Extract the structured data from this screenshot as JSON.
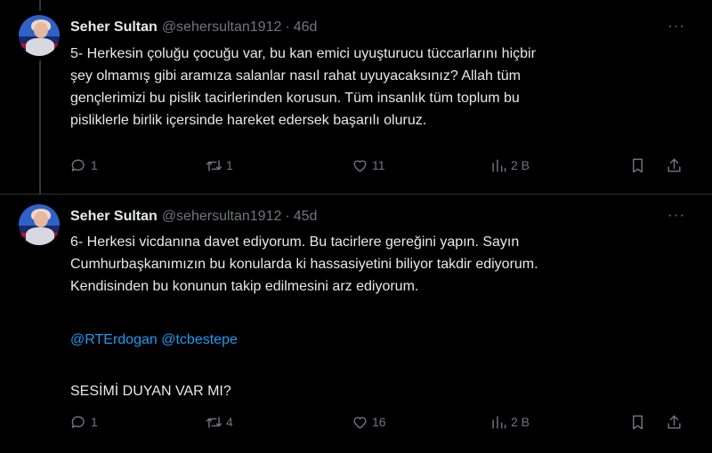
{
  "tweets": [
    {
      "author_name": "Seher Sultan",
      "handle": "@sehersultan1912",
      "separator": "·",
      "time": "46d",
      "body_lines": [
        "5- Herkesin çoluğu çocuğu var, bu kan emici uyuşturucu tüccarlarını hiçbir",
        "şey olmamış gibi aramıza salanlar nasıl rahat uyuyacaksınız? Allah tüm",
        "gençlerimizi bu pislik tacirlerinden korusun. Tüm insanlık tüm toplum bu",
        "pisliklerle birlik içersinde hareket edersek başarılı oluruz."
      ],
      "replies": "1",
      "retweets": "1",
      "likes": "11",
      "views": "2 B"
    },
    {
      "author_name": "Seher Sultan",
      "handle": "@sehersultan1912",
      "separator": "·",
      "time": "45d",
      "body_lines": [
        "6- Herkesi vicdanına davet ediyorum. Bu tacirlere gereğini yapın. Sayın",
        "Cumhurbaşkanımızın bu konularda ki hassasiyetini biliyor takdir ediyorum.",
        "Kendisinden bu konunun takip edilmesini arz ediyorum."
      ],
      "mentions": [
        "@RTErdogan",
        "@tcbestepe"
      ],
      "closing_line": "SESİMİ DUYAN VAR MI?",
      "replies": "1",
      "retweets": "4",
      "likes": "16",
      "views": "2 B"
    }
  ],
  "more_icon_glyph": "···",
  "colors": {
    "background": "#000000",
    "text": "#e7e9ea",
    "muted": "#71767b",
    "link": "#1d9bf0",
    "divider": "#2f3336"
  }
}
